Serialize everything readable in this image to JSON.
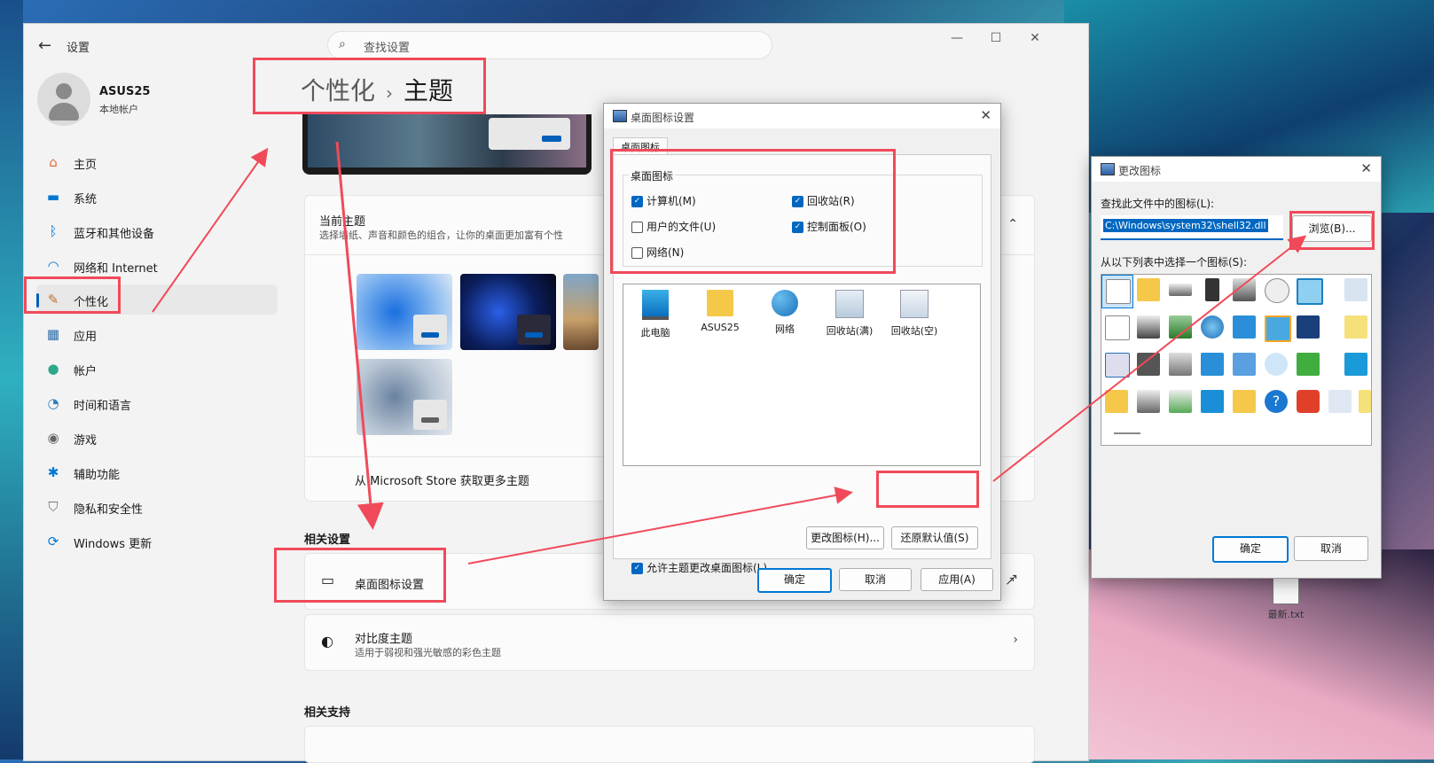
{
  "settings": {
    "app_title": "设置",
    "search_placeholder": "查找设置",
    "user": {
      "name": "ASUS25",
      "account_type": "本地帐户"
    },
    "nav": [
      {
        "label": "主页",
        "icon": "home-icon"
      },
      {
        "label": "系统",
        "icon": "monitor-icon"
      },
      {
        "label": "蓝牙和其他设备",
        "icon": "bluetooth-icon"
      },
      {
        "label": "网络和 Internet",
        "icon": "wifi-icon"
      },
      {
        "label": "个性化",
        "icon": "brush-icon"
      },
      {
        "label": "应用",
        "icon": "apps-icon"
      },
      {
        "label": "帐户",
        "icon": "person-icon"
      },
      {
        "label": "时间和语言",
        "icon": "clock-globe-icon"
      },
      {
        "label": "游戏",
        "icon": "gamepad-icon"
      },
      {
        "label": "辅助功能",
        "icon": "accessibility-icon"
      },
      {
        "label": "隐私和安全性",
        "icon": "shield-icon"
      },
      {
        "label": "Windows 更新",
        "icon": "update-icon"
      }
    ],
    "breadcrumb": {
      "parent": "个性化",
      "separator": "›",
      "current": "主题"
    },
    "current_theme": {
      "title": "当前主题",
      "subtitle": "选择墙纸、声音和颜色的组合，让你的桌面更加富有个性"
    },
    "store_link": "从 Microsoft Store 获取更多主题",
    "related_settings": {
      "heading": "相关设置",
      "items": [
        {
          "title": "桌面图标设置",
          "subtitle": ""
        },
        {
          "title": "对比度主题",
          "subtitle": "适用于弱视和强光敏感的彩色主题"
        }
      ]
    },
    "related_support": "相关支持"
  },
  "desktop_icon_dialog": {
    "title": "桌面图标设置",
    "tab": "桌面图标",
    "group_label": "桌面图标",
    "checkboxes": [
      {
        "label": "计算机(M)",
        "checked": true
      },
      {
        "label": "回收站(R)",
        "checked": true
      },
      {
        "label": "用户的文件(U)",
        "checked": false
      },
      {
        "label": "控制面板(O)",
        "checked": true
      },
      {
        "label": "网络(N)",
        "checked": false
      }
    ],
    "icons": [
      {
        "label": "此电脑",
        "icon": "monitor-icon"
      },
      {
        "label": "ASUS25",
        "icon": "folder-icon"
      },
      {
        "label": "网络",
        "icon": "network-icon"
      },
      {
        "label": "回收站(满)",
        "icon": "recycle-bin-full-icon"
      },
      {
        "label": "回收站(空)",
        "icon": "recycle-bin-empty-icon"
      }
    ],
    "change_icon_button": "更改图标(H)...",
    "restore_default_button": "还原默认值(S)",
    "allow_themes_label": "允许主题更改桌面图标(L)",
    "allow_themes_checked": true,
    "ok": "确定",
    "cancel": "取消",
    "apply": "应用(A)"
  },
  "change_icon_dialog": {
    "title": "更改图标",
    "file_label": "查找此文件中的图标(L):",
    "file_value": "C:\\Windows\\system32\\shell32.dll",
    "browse_button": "浏览(B)...",
    "list_label": "从以下列表中选择一个图标(S):",
    "ok": "确定",
    "cancel": "取消"
  },
  "desktop_file_label": "最新.txt",
  "colors": {
    "accent": "#005fb8",
    "annotation": "#f04a5a"
  }
}
